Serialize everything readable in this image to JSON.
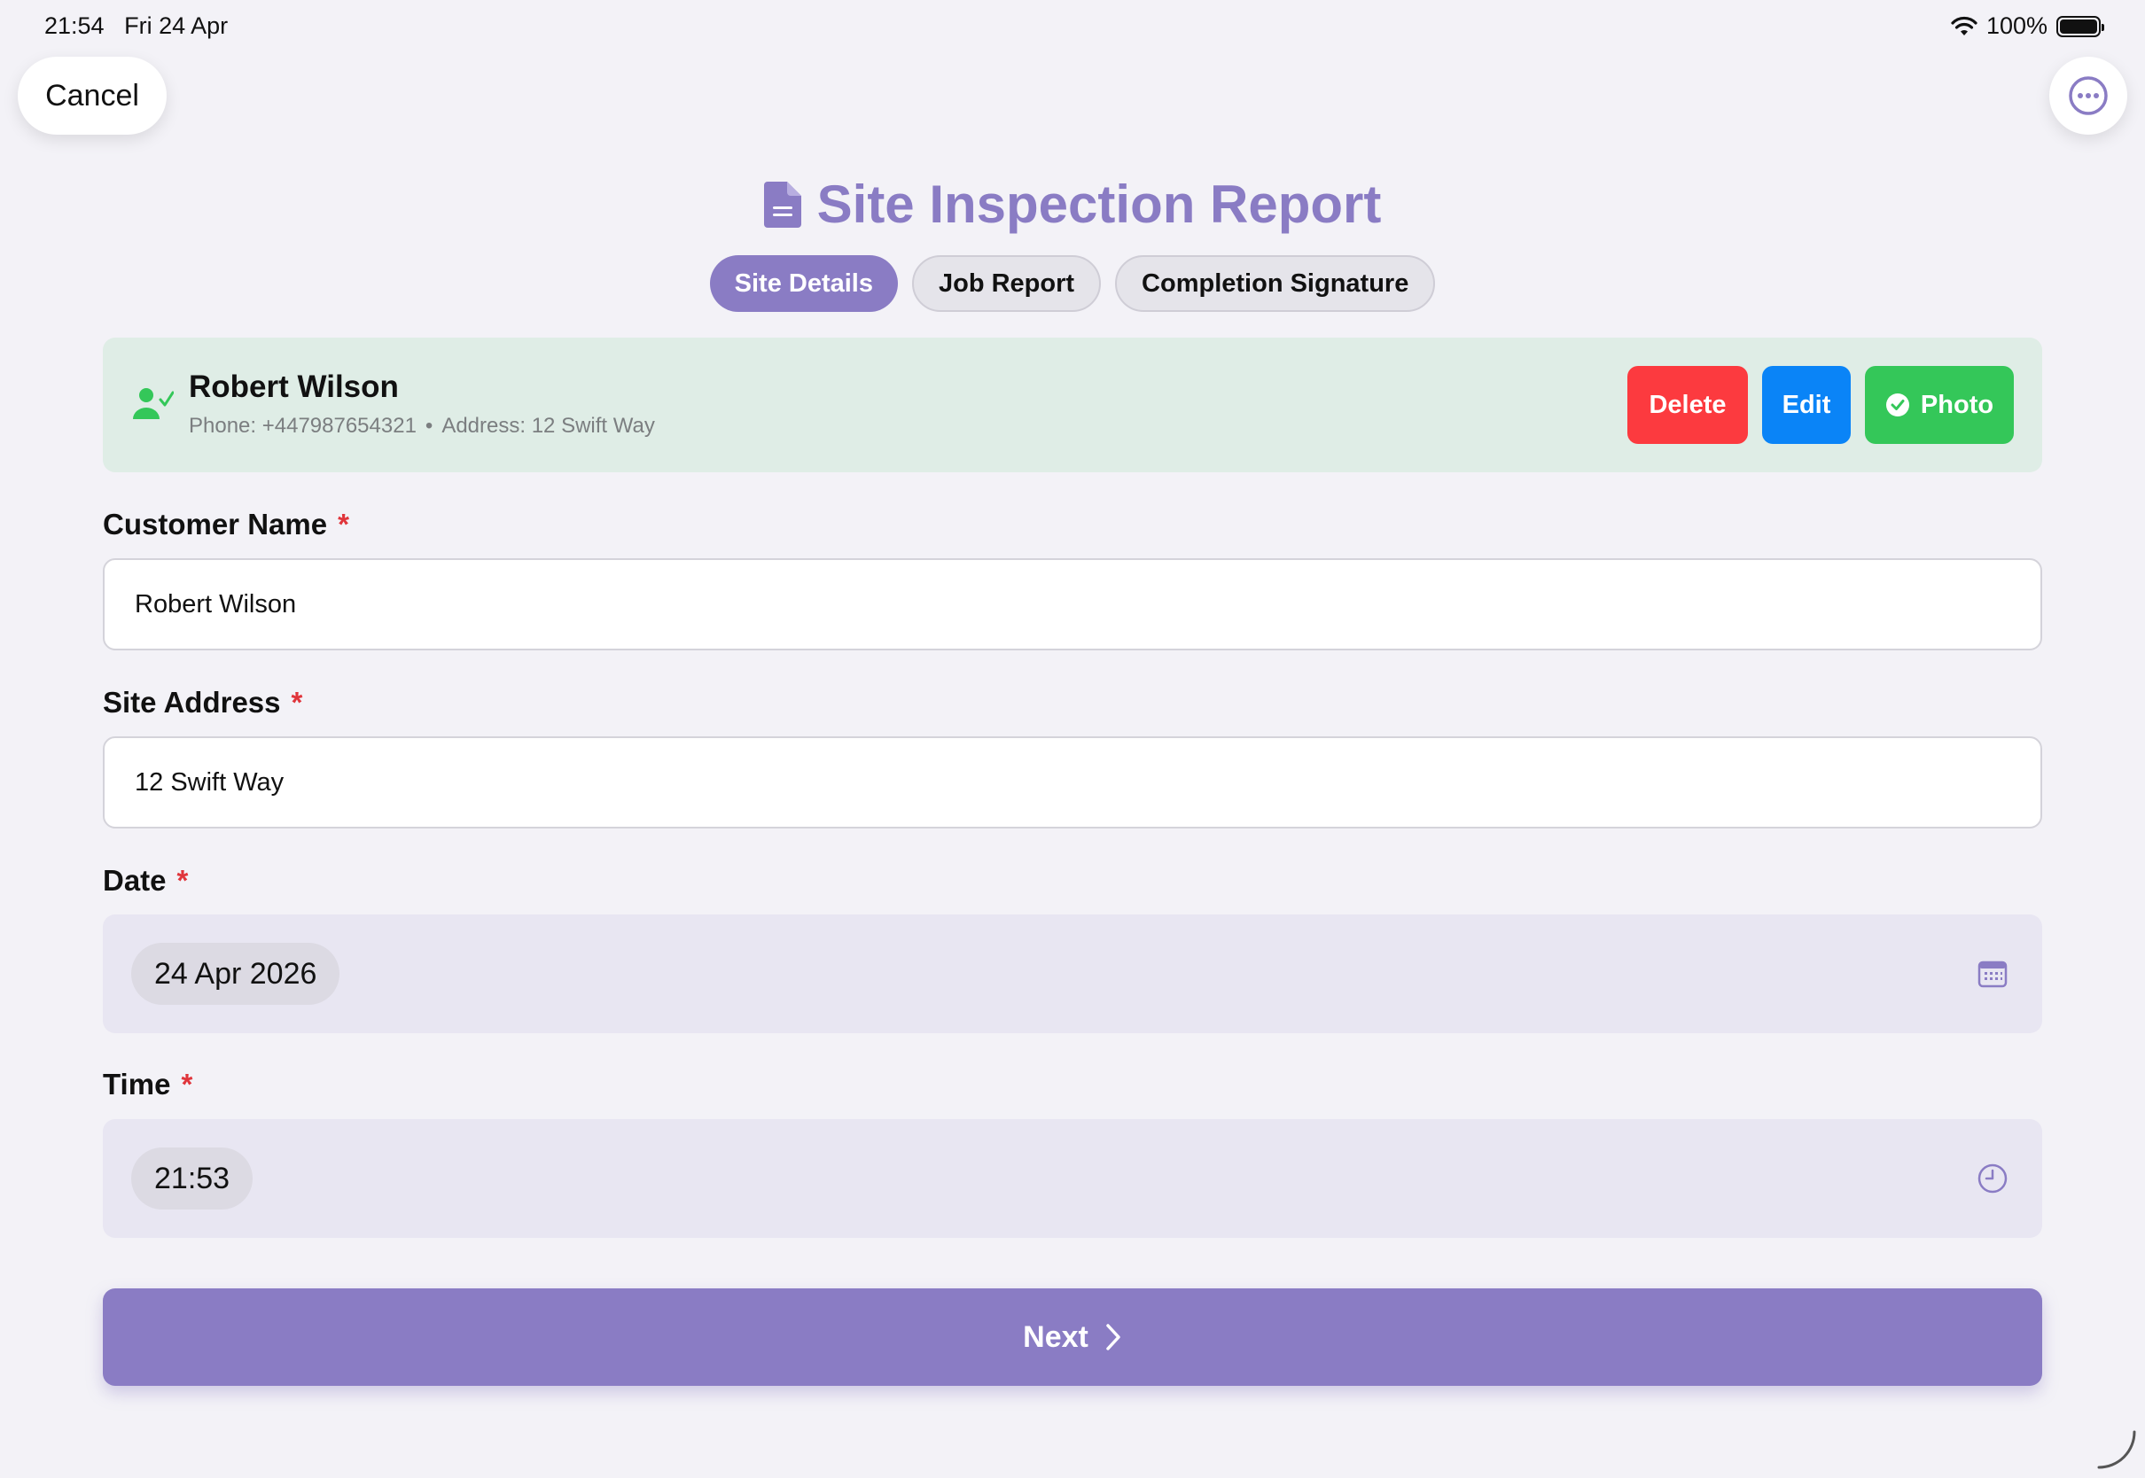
{
  "status_bar": {
    "time": "21:54",
    "date": "Fri 24 Apr",
    "battery": "100%"
  },
  "nav": {
    "cancel_label": "Cancel",
    "more_icon": "ellipsis-circle-icon"
  },
  "header": {
    "title": "Site Inspection Report",
    "icon": "document-icon"
  },
  "tabs": [
    {
      "label": "Site Details",
      "active": true
    },
    {
      "label": "Job Report",
      "active": false
    },
    {
      "label": "Completion Signature",
      "active": false
    }
  ],
  "customer_card": {
    "name": "Robert Wilson",
    "phone": "Phone: +447987654321",
    "separator": "•",
    "address": "Address: 12 Swift Way",
    "delete_label": "Delete",
    "edit_label": "Edit",
    "photo_label": "Photo"
  },
  "form": {
    "customer_name": {
      "label": "Customer Name",
      "required": "*",
      "value": "Robert Wilson"
    },
    "site_address": {
      "label": "Site Address",
      "required": "*",
      "value": "12 Swift Way"
    },
    "date": {
      "label": "Date",
      "required": "*",
      "value": "24 Apr 2026"
    },
    "time": {
      "label": "Time",
      "required": "*",
      "value": "21:53"
    }
  },
  "next_label": "Next",
  "colors": {
    "accent": "#8a7cc4",
    "delete": "#fc3a3f",
    "edit": "#0a84f7",
    "photo": "#34c759",
    "card_bg": "#dfede6",
    "required": "#e0353b"
  }
}
